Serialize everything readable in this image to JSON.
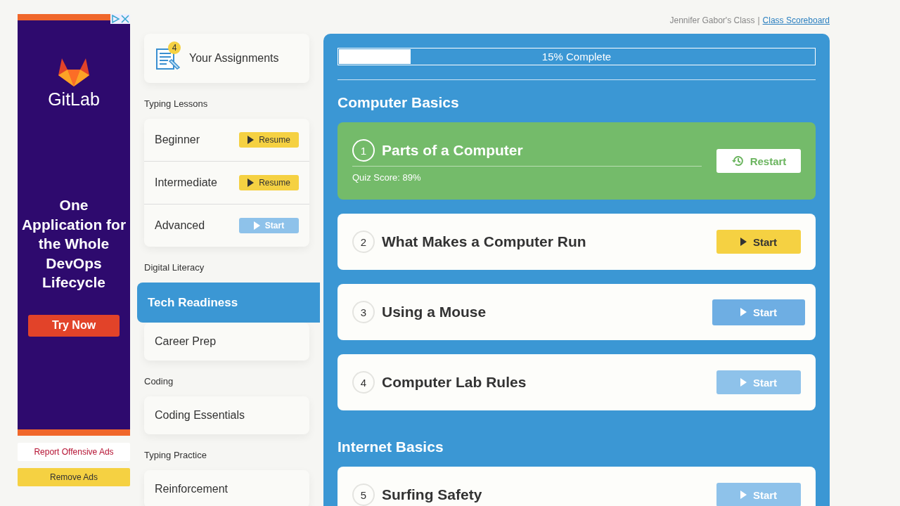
{
  "ad": {
    "brand": "GitLab",
    "headline": "One Application for the Whole DevOps Lifecycle",
    "cta": "Try Now"
  },
  "ad_links": [
    {
      "label": "Report Offensive Ads",
      "kind": "report"
    },
    {
      "label": "Remove Ads",
      "kind": "remove"
    }
  ],
  "header": {
    "class_name": "Jennifer Gabor's Class",
    "separator": "|",
    "link": "Class Scoreboard"
  },
  "sidebar": {
    "assignments": {
      "label": "Your Assignments",
      "count": "4"
    },
    "groups": [
      {
        "title": "Typing Lessons",
        "items": [
          {
            "label": "Beginner",
            "selected": false,
            "button": {
              "label": "Resume",
              "locked": false
            }
          },
          {
            "label": "Intermediate",
            "selected": false,
            "button": {
              "label": "Resume",
              "locked": false
            }
          },
          {
            "label": "Advanced",
            "selected": false,
            "button": {
              "label": "Start",
              "locked": true
            }
          }
        ]
      },
      {
        "title": "Digital Literacy",
        "items": [
          {
            "label": "Tech Readiness",
            "selected": true
          },
          {
            "label": "Career Prep",
            "selected": false
          }
        ]
      },
      {
        "title": "Coding",
        "items": [
          {
            "label": "Coding Essentials",
            "selected": false
          }
        ]
      },
      {
        "title": "Typing Practice",
        "items": [
          {
            "label": "Reinforcement",
            "selected": false
          }
        ]
      }
    ]
  },
  "progress": {
    "level": 0.15,
    "text": "15% Complete"
  },
  "sections": [
    {
      "title": "Computer Basics",
      "lessons": [
        {
          "number": "1",
          "title": "Parts of a Computer",
          "completed": true,
          "hovered": false,
          "score": "Quiz Score: 89%",
          "button": "Restart"
        },
        {
          "number": "2",
          "title": "What Makes a Computer Run",
          "completed": false,
          "locked": false,
          "hovered": false,
          "button": "Start"
        },
        {
          "number": "3",
          "title": "Using a Mouse",
          "completed": false,
          "locked": true,
          "hovered": true,
          "button": "Start"
        },
        {
          "number": "4",
          "title": "Computer Lab Rules",
          "completed": false,
          "locked": true,
          "hovered": false,
          "button": "Start"
        }
      ]
    },
    {
      "title": "Internet Basics",
      "lessons": [
        {
          "number": "5",
          "title": "Surfing Safety",
          "completed": false,
          "locked": true,
          "hovered": false,
          "button": "Start"
        }
      ]
    }
  ]
}
